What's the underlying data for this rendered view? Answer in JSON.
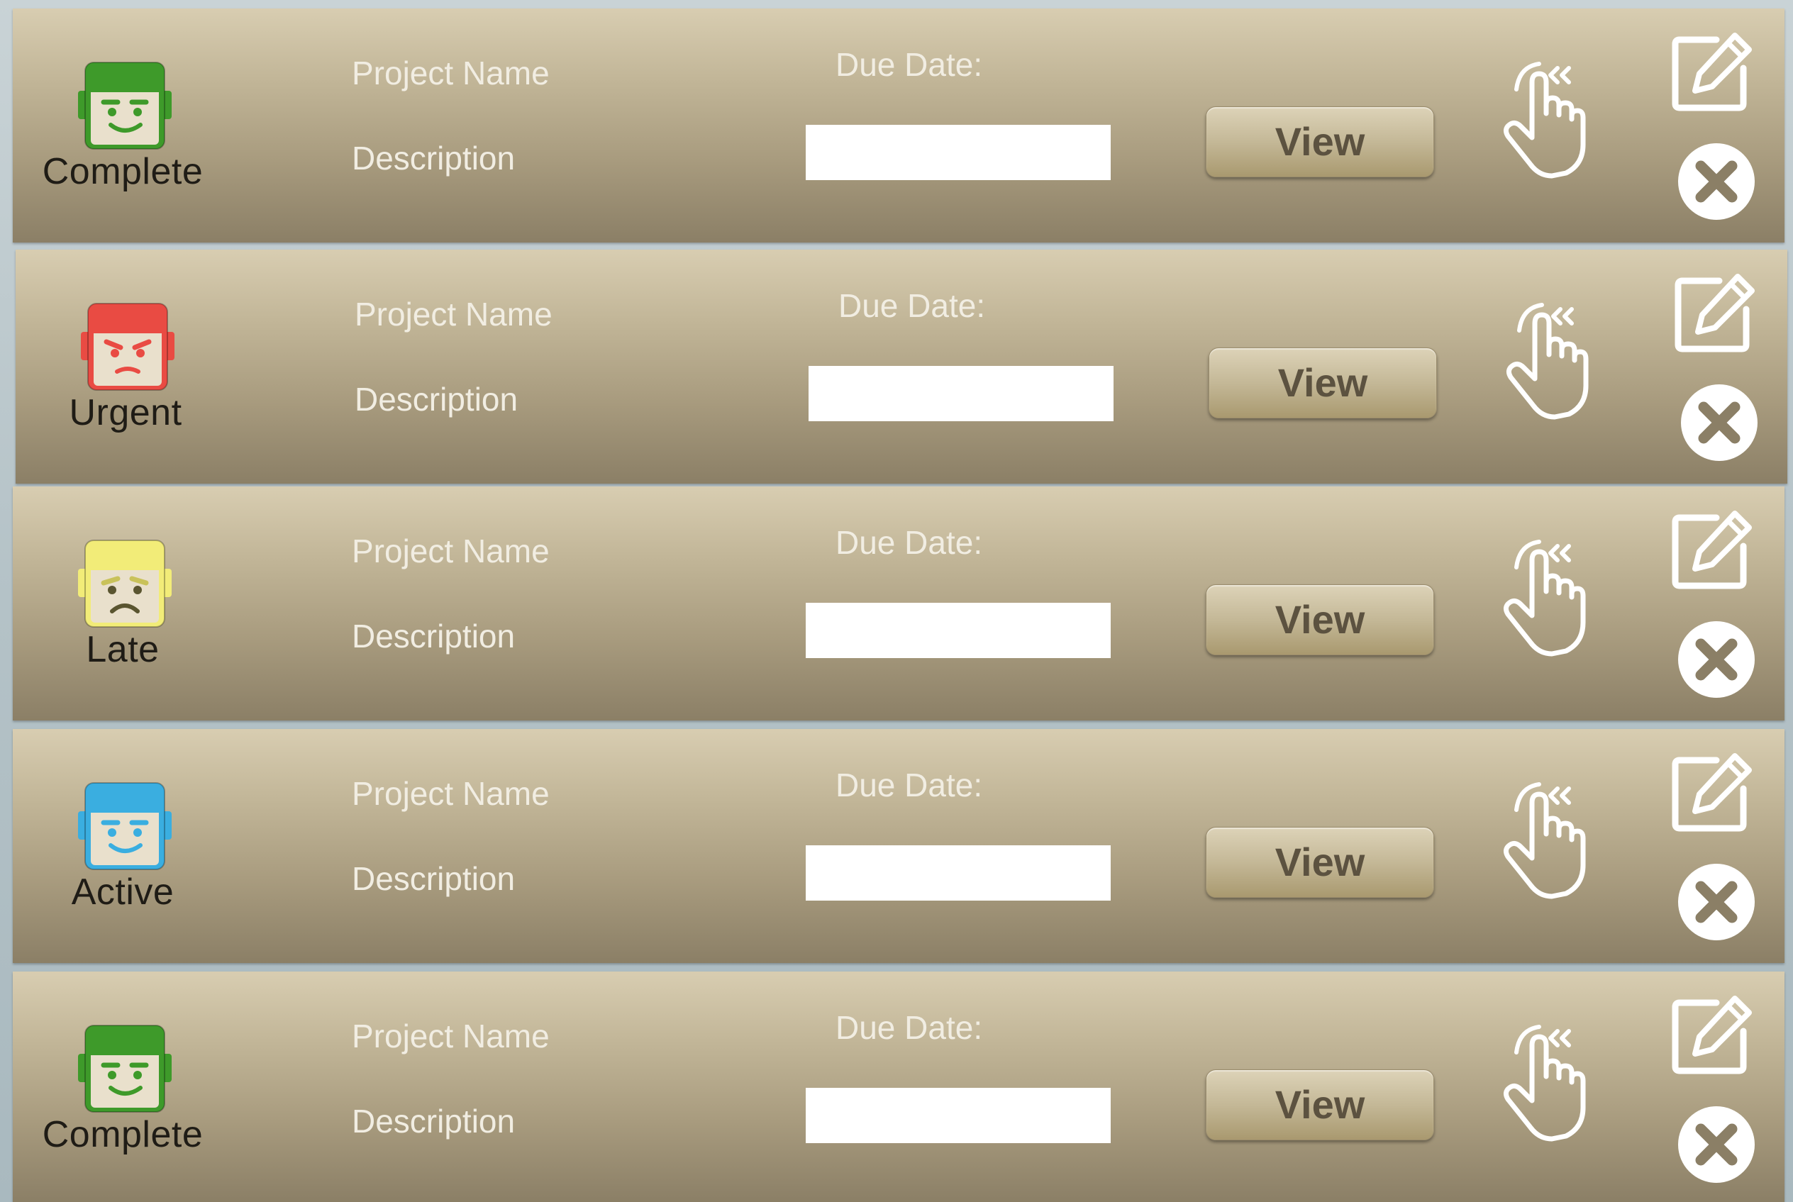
{
  "projects": [
    {
      "status": "Complete",
      "face_color": "#3e9a2a",
      "face_mood": "happy",
      "name_label": "Project Name",
      "description_label": "Description",
      "due_label": "Due Date:",
      "due_value": "",
      "view_label": "View"
    },
    {
      "status": "Urgent",
      "face_color": "#e94b43",
      "face_mood": "angry",
      "name_label": "Project Name",
      "description_label": "Description",
      "due_label": "Due Date:",
      "due_value": "",
      "view_label": "View"
    },
    {
      "status": "Late",
      "face_color": "#f2ec78",
      "face_mood": "sad",
      "name_label": "Project Name",
      "description_label": "Description",
      "due_label": "Due Date:",
      "due_value": "",
      "view_label": "View"
    },
    {
      "status": "Active",
      "face_color": "#3aaee0",
      "face_mood": "happy",
      "name_label": "Project Name",
      "description_label": "Description",
      "due_label": "Due Date:",
      "due_value": "",
      "view_label": "View"
    },
    {
      "status": "Complete",
      "face_color": "#3e9a2a",
      "face_mood": "happy",
      "name_label": "Project Name",
      "description_label": "Description",
      "due_label": "Due Date:",
      "due_value": "",
      "view_label": "View"
    }
  ],
  "icons": {
    "status": "robot-face-icon",
    "tap": "tap-gesture-icon",
    "edit": "edit-icon",
    "delete": "delete-circle-x-icon"
  }
}
